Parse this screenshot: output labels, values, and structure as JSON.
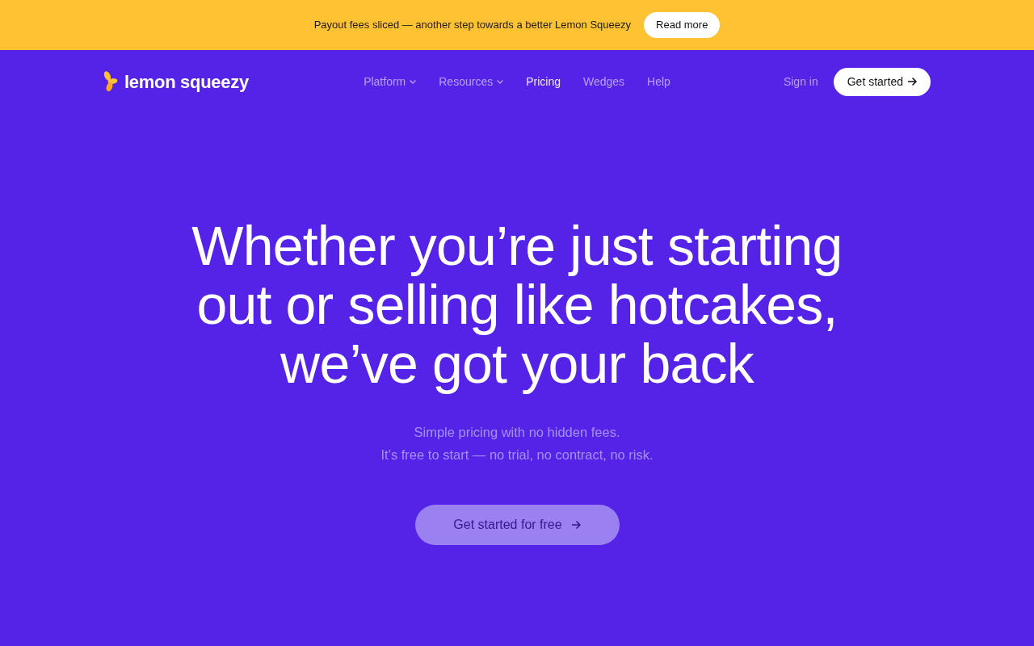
{
  "announcement": {
    "text": "Payout fees sliced — another step towards a better Lemon Squeezy",
    "button": "Read more"
  },
  "navbar": {
    "logo": "lemon squeezy",
    "links": [
      {
        "label": "Platform",
        "kind": "dropdown",
        "selected": false
      },
      {
        "label": "Resources",
        "kind": "dropdown",
        "selected": false
      },
      {
        "label": "Pricing",
        "kind": "link",
        "selected": true
      },
      {
        "label": "Wedges",
        "kind": "link",
        "selected": false
      },
      {
        "label": "Help",
        "kind": "link",
        "selected": false
      }
    ],
    "sign_in": "Sign in",
    "cta": "Get started"
  },
  "hero": {
    "title_lines": [
      "Whether you’re just starting",
      "out or selling like hotcakes,",
      "we’ve got your back"
    ],
    "subtitle_lines": [
      "Simple pricing with no hidden fees.",
      "It’s free to start — no trial, no contract, no risk."
    ],
    "cta": "Get started for free"
  }
}
